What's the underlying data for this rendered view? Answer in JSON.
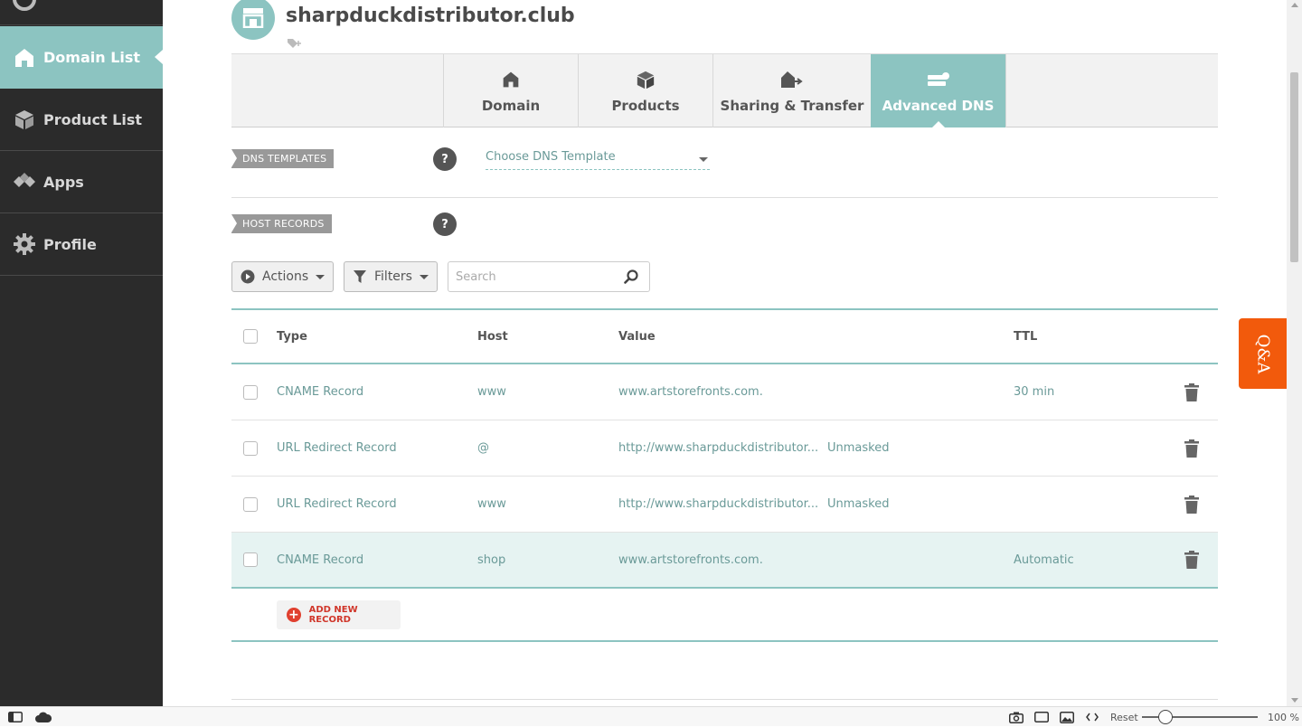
{
  "sidebar": {
    "items": [
      {
        "label": "Domain List",
        "icon": "home-icon",
        "active": true
      },
      {
        "label": "Product List",
        "icon": "box-icon"
      },
      {
        "label": "Apps",
        "icon": "apps-icon"
      },
      {
        "label": "Profile",
        "icon": "gear-icon"
      }
    ]
  },
  "header": {
    "domain": "sharpduckdistributor.club"
  },
  "tabs": [
    {
      "label": "Domain",
      "icon": "home-icon"
    },
    {
      "label": "Products",
      "icon": "box-icon"
    },
    {
      "label": "Sharing & Transfer",
      "icon": "transfer-icon"
    },
    {
      "label": "Advanced DNS",
      "icon": "dns-server-icon",
      "active": true
    }
  ],
  "dns_templates": {
    "label": "DNS TEMPLATES",
    "help": "?",
    "select_value": "Choose DNS Template"
  },
  "host_records": {
    "label": "HOST RECORDS",
    "help": "?"
  },
  "toolbar": {
    "actions_label": "Actions",
    "filters_label": "Filters",
    "search_placeholder": "Search"
  },
  "table": {
    "columns": [
      "Type",
      "Host",
      "Value",
      "TTL"
    ],
    "rows": [
      {
        "type": "CNAME Record",
        "host": "www",
        "value": "www.artstorefronts.com.",
        "extra": "",
        "ttl": "30 min"
      },
      {
        "type": "URL Redirect Record",
        "host": "@",
        "value": "http://www.sharpduckdistributor...",
        "extra": "Unmasked",
        "ttl": ""
      },
      {
        "type": "URL Redirect Record",
        "host": "www",
        "value": "http://www.sharpduckdistributor...",
        "extra": "Unmasked",
        "ttl": ""
      },
      {
        "type": "CNAME Record",
        "host": "shop",
        "value": "www.artstorefronts.com.",
        "extra": "",
        "ttl": "Automatic"
      }
    ]
  },
  "add_record_label": "ADD NEW RECORD",
  "qa_label": "Q&A",
  "statusbar": {
    "reset_label": "Reset",
    "zoom": "100 %"
  },
  "colors": {
    "accent": "#8cc4c1",
    "sidebar": "#2b2b2b",
    "qa": "#f25a0c",
    "add": "#e0402f"
  }
}
